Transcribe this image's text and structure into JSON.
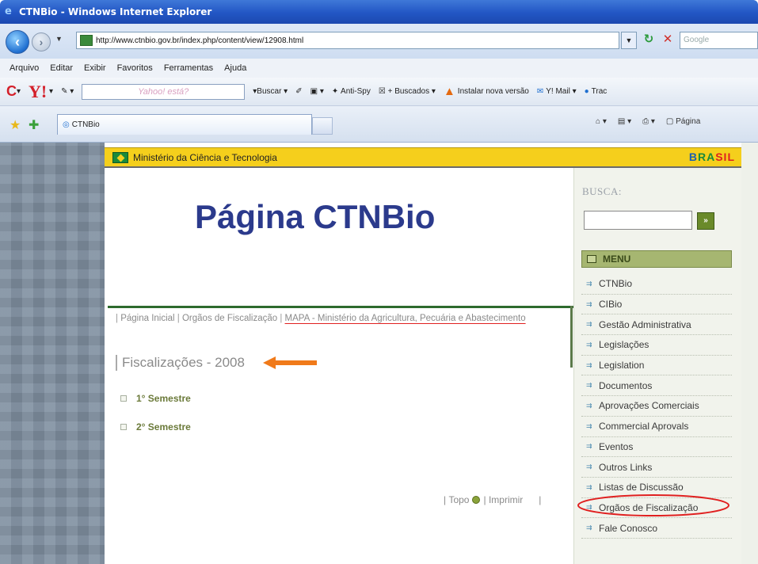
{
  "window": {
    "title": "CTNBio - Windows Internet Explorer"
  },
  "address_bar": {
    "url": "http://www.ctnbio.gov.br/index.php/content/view/12908.html",
    "search_placeholder": "Google"
  },
  "menubar": {
    "items": [
      "Arquivo",
      "Editar",
      "Exibir",
      "Favoritos",
      "Ferramentas",
      "Ajuda"
    ]
  },
  "toolbar": {
    "yahoo_search_placeholder": "Yahoo! está?",
    "buscar": "Buscar",
    "anti_spy": "Anti-Spy",
    "buscados": "+ Buscados",
    "instalar": "Instalar nova versão",
    "ymail": "Y! Mail",
    "track": "Trac"
  },
  "tabs": {
    "active": "CTNBio"
  },
  "command_bar": {
    "pagina": "Página"
  },
  "gov_bar": {
    "label": "Ministério da Ciência e Tecnologia",
    "brasil_logo": "BRASIL"
  },
  "page": {
    "heading": "Página CTNBio",
    "breadcrumb": {
      "home": "Página Inicial",
      "orgaos": "Orgãos de Fiscalização",
      "mapa": "MAPA - Ministério da Agricultura, Pecuária e Abastecimento"
    },
    "section_title": "Fiscalizações - 2008",
    "semesters": [
      "1° Semestre",
      "2° Semestre"
    ],
    "footer": {
      "topo": "Topo",
      "imprimir": "Imprimir"
    }
  },
  "sidebar": {
    "busca_label": "BUSCA:",
    "busca_button": "»",
    "menu_title": "MENU",
    "menu_items": [
      "CTNBio",
      "CIBio",
      "Gestão Administrativa",
      "Legislações",
      "Legislation",
      "Documentos",
      "Aprovações Comerciais",
      "Commercial Aprovals",
      "Eventos",
      "Outros Links",
      "Listas de Discussão",
      "Orgãos de Fiscalização",
      "Fale Conosco"
    ]
  },
  "colors": {
    "heading": "#2b3a8c",
    "gov_bar": "#f5cf1c",
    "menu_header": "#a6b671",
    "annotation_red": "#e02020",
    "annotation_orange": "#f07a1a"
  }
}
